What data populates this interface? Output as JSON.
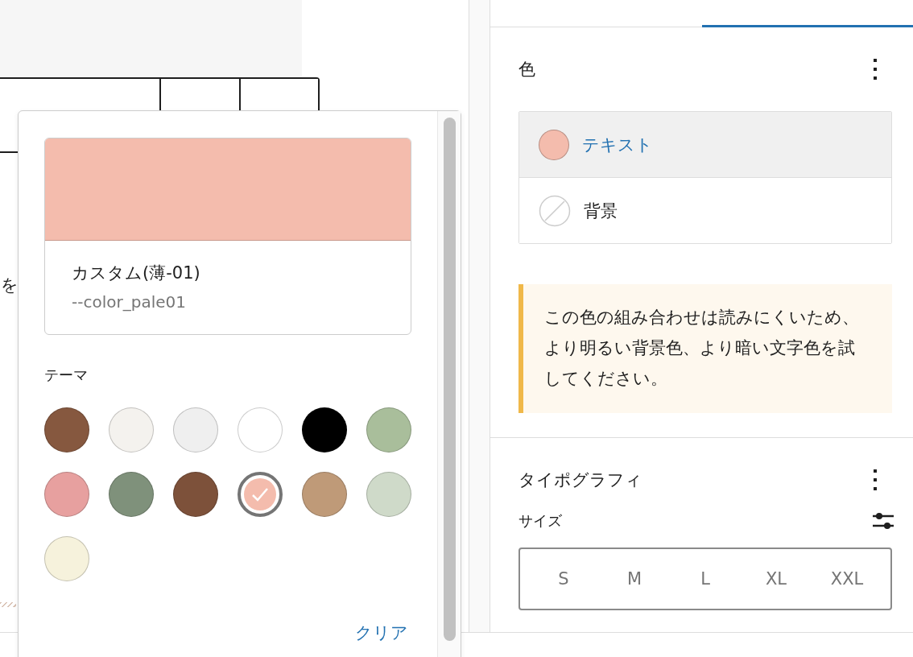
{
  "canvas": {
    "cut_text": "を"
  },
  "sidebar": {
    "tabs": [
      {
        "selected": false
      },
      {
        "selected": true
      }
    ],
    "color_panel": {
      "title": "色",
      "items": [
        {
          "kind": "swatch",
          "label": "テキスト",
          "selected": true,
          "color": "#f4bcad"
        },
        {
          "kind": "none",
          "label": "背景",
          "selected": false
        }
      ],
      "notice": "この色の組み合わせは読みにくいため、より明るい背景色、より暗い文字色を試してください。"
    },
    "typography_panel": {
      "title": "タイポグラフィ",
      "size_label": "サイズ",
      "sizes": [
        {
          "label": "S",
          "selected": false
        },
        {
          "label": "M",
          "selected": false
        },
        {
          "label": "L",
          "selected": false
        },
        {
          "label": "XL",
          "selected": false
        },
        {
          "label": "XXL",
          "selected": false
        }
      ]
    }
  },
  "popover": {
    "preview": {
      "color": "#f4bcad",
      "name": "カスタム(薄-01)",
      "variable": "--color_pale01"
    },
    "palette_label": "テーマ",
    "swatches": [
      {
        "color": "#86583f",
        "selected": false
      },
      {
        "color": "#f4f2ee",
        "selected": false
      },
      {
        "color": "#efefef",
        "selected": false
      },
      {
        "color": "#ffffff",
        "selected": false
      },
      {
        "color": "#000000",
        "selected": false
      },
      {
        "color": "#a9be9b",
        "selected": false
      },
      {
        "color": "#e7a09f",
        "selected": false
      },
      {
        "color": "#7f917b",
        "selected": false
      },
      {
        "color": "#7d513a",
        "selected": false
      },
      {
        "color": "#f4bcad",
        "selected": true
      },
      {
        "color": "#bf9a78",
        "selected": false
      },
      {
        "color": "#cfdac9",
        "selected": false
      },
      {
        "color": "#f6f2dc",
        "selected": false
      }
    ],
    "clear": "クリア"
  }
}
